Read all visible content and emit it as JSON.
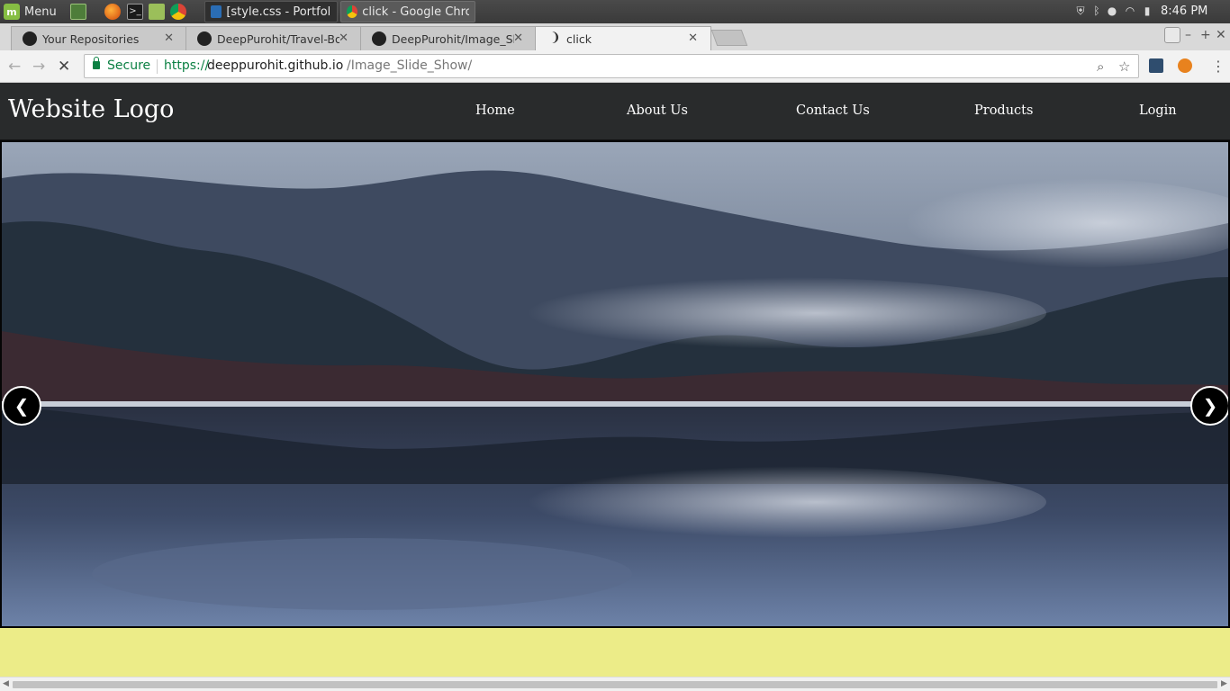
{
  "taskbar": {
    "menu_label": "Menu",
    "windows": [
      {
        "label": "[style.css - Portfoli…",
        "state": "inactive"
      },
      {
        "label": "click - Google Chro…",
        "state": "active"
      }
    ],
    "clock": "8:46 PM"
  },
  "tabs": [
    {
      "title": "Your Repositories",
      "icon": "github-icon"
    },
    {
      "title": "DeepPurohit/Travel-Boo",
      "icon": "github-icon"
    },
    {
      "title": "DeepPurohit/Image_Slid",
      "icon": "github-icon"
    },
    {
      "title": "click",
      "icon": "loading-spinner-icon"
    }
  ],
  "toolbar": {
    "secure_label": "Secure",
    "url_scheme": "https://",
    "url_host": "deeppurohit.github.io",
    "url_path": "/Image_Slide_Show/"
  },
  "site": {
    "logo": "Website Logo",
    "nav": [
      "Home",
      "About Us",
      "Contact Us",
      "Products",
      "Login"
    ]
  },
  "slideshow": {
    "prev_glyph": "❮",
    "next_glyph": "❯"
  },
  "colors": {
    "header_bg": "#292b2c",
    "page_bg": "#ecec88",
    "secure_green": "#0b8043"
  }
}
